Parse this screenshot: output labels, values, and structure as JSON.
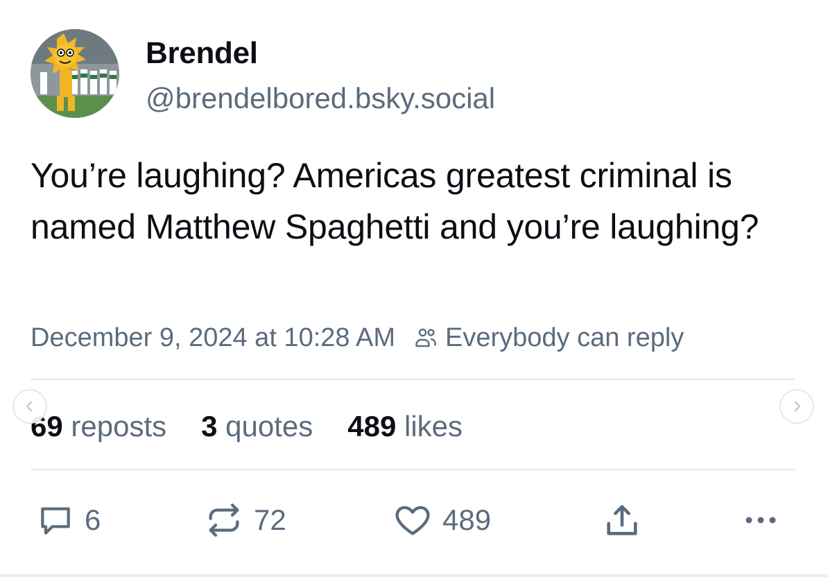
{
  "author": {
    "display_name": "Brendel",
    "handle": "@brendelbored.bsky.social",
    "avatar_icon": "mascot-avatar"
  },
  "post": {
    "text": "You’re laughing? Americas greatest criminal is named Matthew Spaghetti and you’re laughing?",
    "timestamp": "December 9, 2024 at 10:28 AM",
    "reply_setting": "Everybody can reply"
  },
  "stats": {
    "reposts_count": "69",
    "reposts_label": "reposts",
    "quotes_count": "3",
    "quotes_label": "quotes",
    "likes_count": "489",
    "likes_label": "likes"
  },
  "actions": {
    "reply_count": "6",
    "repost_count": "72",
    "like_count": "489",
    "icons": [
      "reply-icon",
      "repost-icon",
      "like-icon",
      "share-icon",
      "more-icon"
    ]
  },
  "colors": {
    "text_primary": "#0b0f14",
    "text_secondary": "#5b6b7d",
    "divider": "#e4e8ec"
  }
}
